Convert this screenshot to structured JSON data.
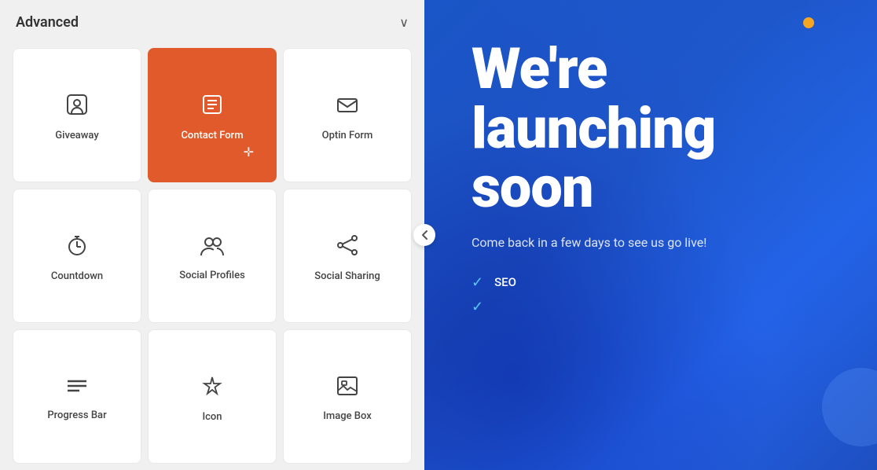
{
  "panel": {
    "title": "Advanced",
    "chevron": "∨",
    "collapse_arrow": "<"
  },
  "grid_items": [
    {
      "id": "giveaway",
      "label": "Giveaway",
      "icon": "giveaway-icon",
      "active": false
    },
    {
      "id": "contact-form",
      "label": "Contact Form",
      "icon": "contact-form-icon",
      "active": true
    },
    {
      "id": "optin-form",
      "label": "Optin Form",
      "icon": "optin-form-icon",
      "active": false
    },
    {
      "id": "countdown",
      "label": "Countdown",
      "icon": "countdown-icon",
      "active": false
    },
    {
      "id": "social-profiles",
      "label": "Social Profiles",
      "icon": "social-profiles-icon",
      "active": false
    },
    {
      "id": "social-sharing",
      "label": "Social Sharing",
      "icon": "social-sharing-icon",
      "active": false
    },
    {
      "id": "progress-bar",
      "label": "Progress Bar",
      "icon": "progress-bar-icon",
      "active": false
    },
    {
      "id": "icon",
      "label": "Icon",
      "icon": "icon-widget-icon",
      "active": false
    },
    {
      "id": "image-box",
      "label": "Image Box",
      "icon": "image-box-icon",
      "active": false
    }
  ],
  "hero": {
    "title": "We're launching soon",
    "subtitle": "Come back in a few days to see us go live!",
    "features": [
      {
        "text": "SEO"
      },
      {
        "text": ""
      }
    ]
  }
}
